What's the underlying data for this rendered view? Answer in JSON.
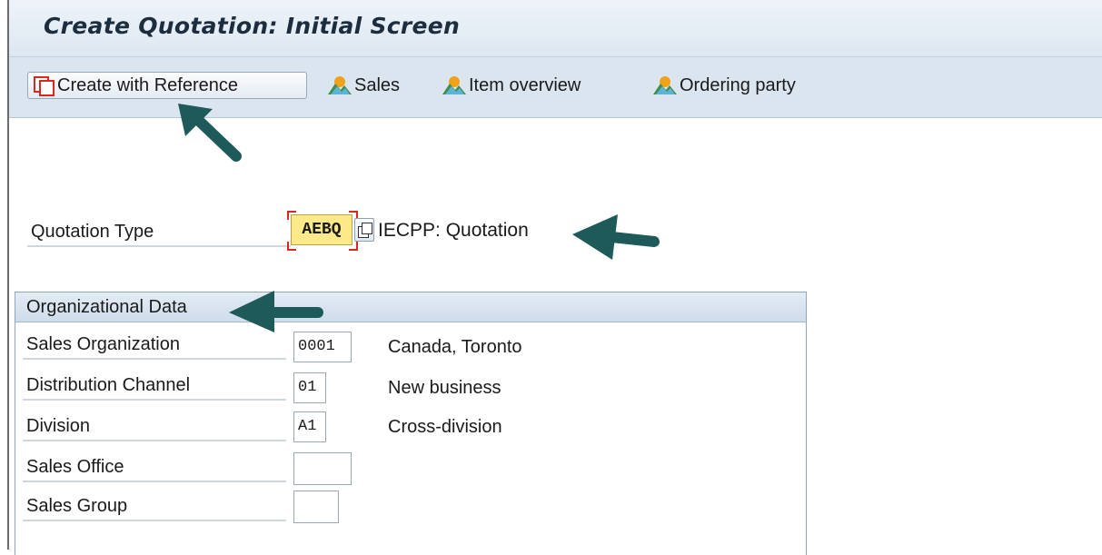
{
  "title": "Create Quotation: Initial Screen",
  "toolbar": {
    "create_with_reference": "Create with Reference",
    "sales": "Sales",
    "item_overview": "Item overview",
    "ordering_party": "Ordering party"
  },
  "quotation_type": {
    "label": "Quotation Type",
    "value": "AEBQ",
    "description": "IECPP: Quotation"
  },
  "org_data": {
    "heading": "Organizational Data",
    "fields": [
      {
        "label": "Sales Organization",
        "value": "0001",
        "description": "Canada, Toronto"
      },
      {
        "label": "Distribution Channel",
        "value": "01",
        "description": "New business"
      },
      {
        "label": "Division",
        "value": "A1",
        "description": "Cross-division"
      },
      {
        "label": "Sales Office",
        "value": "",
        "description": ""
      },
      {
        "label": "Sales Group",
        "value": "",
        "description": ""
      }
    ]
  },
  "colors": {
    "title_bar": "#dde7f1",
    "toolbar": "#dae5ef",
    "required_field": "#fbe98a",
    "annotation_arrow": "#1f5a5a"
  },
  "icons": [
    "reference-icon",
    "mountain-icon",
    "matchcode-icon",
    "annotation-arrow"
  ]
}
